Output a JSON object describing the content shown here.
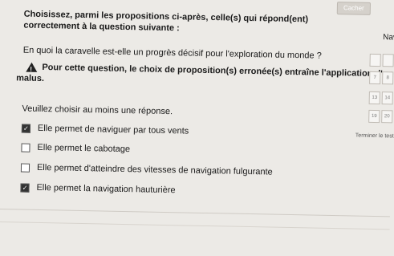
{
  "top_button": {
    "label": "Cacher"
  },
  "question": {
    "heading": "Choisissez, parmi les propositions ci-après, celle(s) qui répond(ent) correctement à la question suivante :",
    "text": "En quoi la caravelle est-elle un progrès décisif pour l'exploration du monde ?"
  },
  "warning": {
    "line1": "Pour cette question, le choix de proposition(s) erronée(s) entraîne l'application d'un",
    "line2": "malus."
  },
  "instruction": "Veuillez choisir au moins une réponse.",
  "answers": [
    {
      "label": "Elle permet de naviguer par tous vents",
      "checked": true
    },
    {
      "label": "Elle permet le cabotage",
      "checked": false
    },
    {
      "label": "Elle permet d'atteindre des vitesses de navigation fulgurante",
      "checked": false
    },
    {
      "label": "Elle permet la navigation hauturière",
      "checked": true
    }
  ],
  "navigation": {
    "title": "Nav",
    "cells": [
      "",
      "",
      "7",
      "8",
      "13",
      "14",
      "19",
      "20"
    ],
    "finish": "Terminer le test"
  }
}
